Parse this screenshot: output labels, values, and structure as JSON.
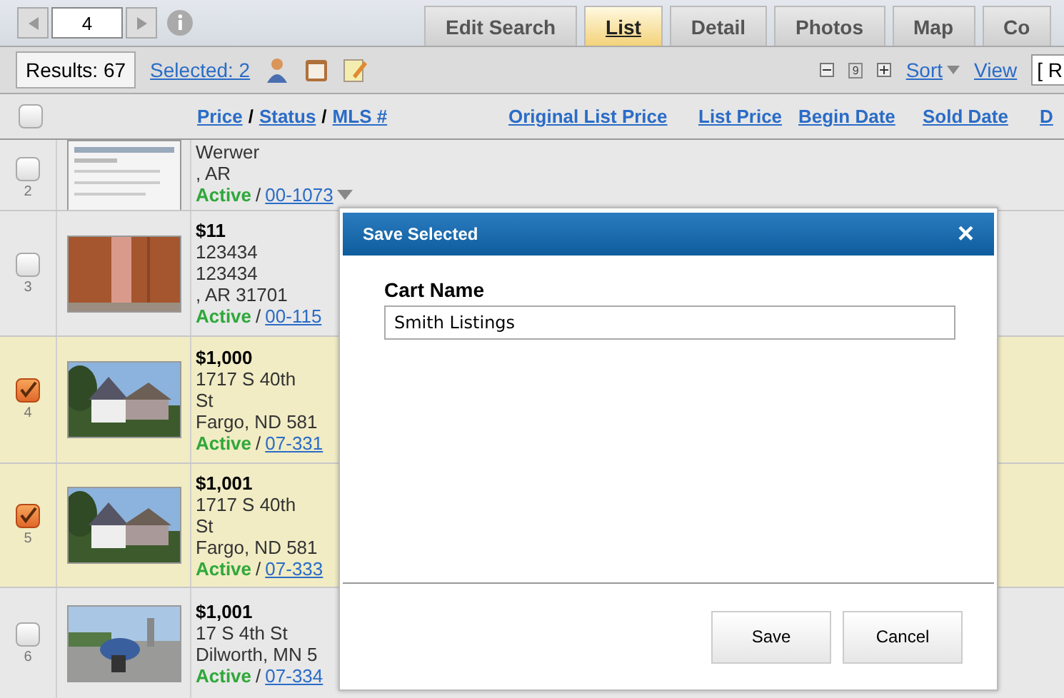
{
  "pager": {
    "page": "4"
  },
  "tabs": [
    {
      "label": "Edit Search",
      "selected": false
    },
    {
      "label": "List",
      "selected": true
    },
    {
      "label": "Detail",
      "selected": false
    },
    {
      "label": "Photos",
      "selected": false
    },
    {
      "label": "Map",
      "selected": false
    },
    {
      "label": "Co",
      "selected": false
    }
  ],
  "toolbar": {
    "results": "Results: 67",
    "selected": "Selected: 2",
    "page_size": "9",
    "sort": "Sort",
    "view": "View",
    "report": "[ R"
  },
  "table": {
    "select_all": {
      "checked": false
    },
    "columns": [
      {
        "parts": [
          "Price",
          "Status",
          "MLS #"
        ],
        "separator": "/"
      },
      {
        "parts": [
          "Original List Price"
        ]
      },
      {
        "parts": [
          "List Price"
        ]
      },
      {
        "parts": [
          "Begin Date"
        ]
      },
      {
        "parts": [
          "Sold Date"
        ]
      },
      {
        "parts": [
          "D"
        ]
      }
    ],
    "rows": [
      {
        "number": "2",
        "selected": false,
        "lines": [
          "Werwer",
          ", AR"
        ],
        "status": "Active",
        "separator": "/",
        "mls": "00-1073",
        "menu": true,
        "kind": "document"
      },
      {
        "number": "3",
        "selected": false,
        "price": "$11",
        "lines": [
          "123434",
          "123434",
          ", AR 31701"
        ],
        "status": "Active",
        "separator": "/",
        "mls": "00-115",
        "menu": false,
        "kind": "door"
      },
      {
        "number": "4",
        "selected": true,
        "price": "$1,000",
        "lines": [
          "1717 S 40th",
          "St",
          "Fargo, ND 581"
        ],
        "status": "Active",
        "separator": "/",
        "mls": "07-331",
        "menu": false,
        "kind": "house"
      },
      {
        "number": "5",
        "selected": true,
        "price": "$1,001",
        "lines": [
          "1717 S 40th",
          "St",
          "Fargo, ND 581"
        ],
        "status": "Active",
        "separator": "/",
        "mls": "07-333",
        "menu": false,
        "kind": "house"
      },
      {
        "number": "6",
        "selected": false,
        "price": "$1,001",
        "lines": [
          "17 S 4th St",
          "Dilworth, MN 5"
        ],
        "status": "Active",
        "separator": "/",
        "mls": "07-334",
        "menu": false,
        "kind": "street"
      }
    ]
  },
  "dialog": {
    "title": "Save Selected",
    "close": "×",
    "field_label": "Cart Name",
    "field_value": "Smith Listings",
    "buttons": [
      "Save",
      "Cancel"
    ]
  }
}
